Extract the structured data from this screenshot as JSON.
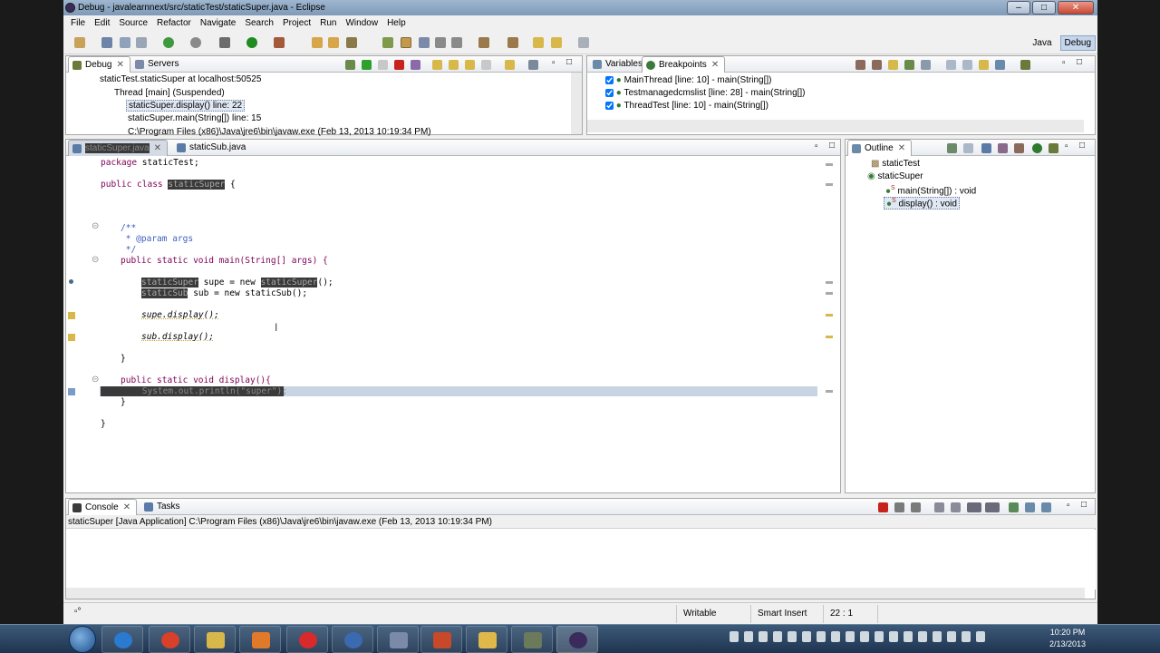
{
  "window": {
    "title": "Debug - javalearnnext/src/staticTest/staticSuper.java - Eclipse"
  },
  "menu": [
    "File",
    "Edit",
    "Source",
    "Refactor",
    "Navigate",
    "Search",
    "Project",
    "Run",
    "Window",
    "Help"
  ],
  "perspectives": {
    "java": "Java",
    "debug": "Debug"
  },
  "debug_view": {
    "tabs": {
      "debug": "Debug",
      "servers": "Servers"
    },
    "tree": [
      "staticTest.staticSuper at localhost:50525",
      "Thread [main] (Suspended)",
      "staticSuper.display() line: 22",
      "staticSuper.main(String[]) line: 15",
      "C:\\Program Files (x86)\\Java\\jre6\\bin\\javaw.exe (Feb 13, 2013 10:19:34 PM)"
    ]
  },
  "breakpoints_view": {
    "tabs": {
      "variables": "Variables",
      "breakpoints": "Breakpoints"
    },
    "items": [
      "MainThread [line: 10] - main(String[])",
      "Testmanagedcmslist [line: 28] - main(String[])",
      "ThreadTest [line: 10] - main(String[])"
    ]
  },
  "editor": {
    "tabs": {
      "active": "staticSuper.java",
      "other": "staticSub.java"
    },
    "lines": {
      "l1": "package staticTest;",
      "l2a": "public class ",
      "l2b": "staticSuper",
      "l2c": " {",
      "l3": "/**",
      "l4": " * @param args",
      "l5": " */",
      "l6": "public static void main(String[] args) {",
      "l7a": "staticSuper",
      "l7b": " supe = new ",
      "l7c": "staticSuper",
      "l7d": "();",
      "l8a": "staticSub",
      "l8b": " sub = new staticSub();",
      "l9": "supe.display();",
      "l10": "sub.display();",
      "l11": "}",
      "l12": "public static void display(){",
      "l13": "System.out.println(\"super\");",
      "l14": "}",
      "l15": "}"
    }
  },
  "outline": {
    "tab": "Outline",
    "items": [
      "staticTest",
      "staticSuper",
      "main(String[]) : void",
      "display() : void"
    ]
  },
  "console": {
    "tabs": {
      "console": "Console",
      "tasks": "Tasks"
    },
    "header": "staticSuper [Java Application] C:\\Program Files (x86)\\Java\\jre6\\bin\\javaw.exe (Feb 13, 2013 10:19:34 PM)"
  },
  "status": {
    "writable": "Writable",
    "insert": "Smart Insert",
    "position": "22 : 1"
  },
  "taskbar": {
    "time": "10:20 PM",
    "date": "2/13/2013"
  }
}
